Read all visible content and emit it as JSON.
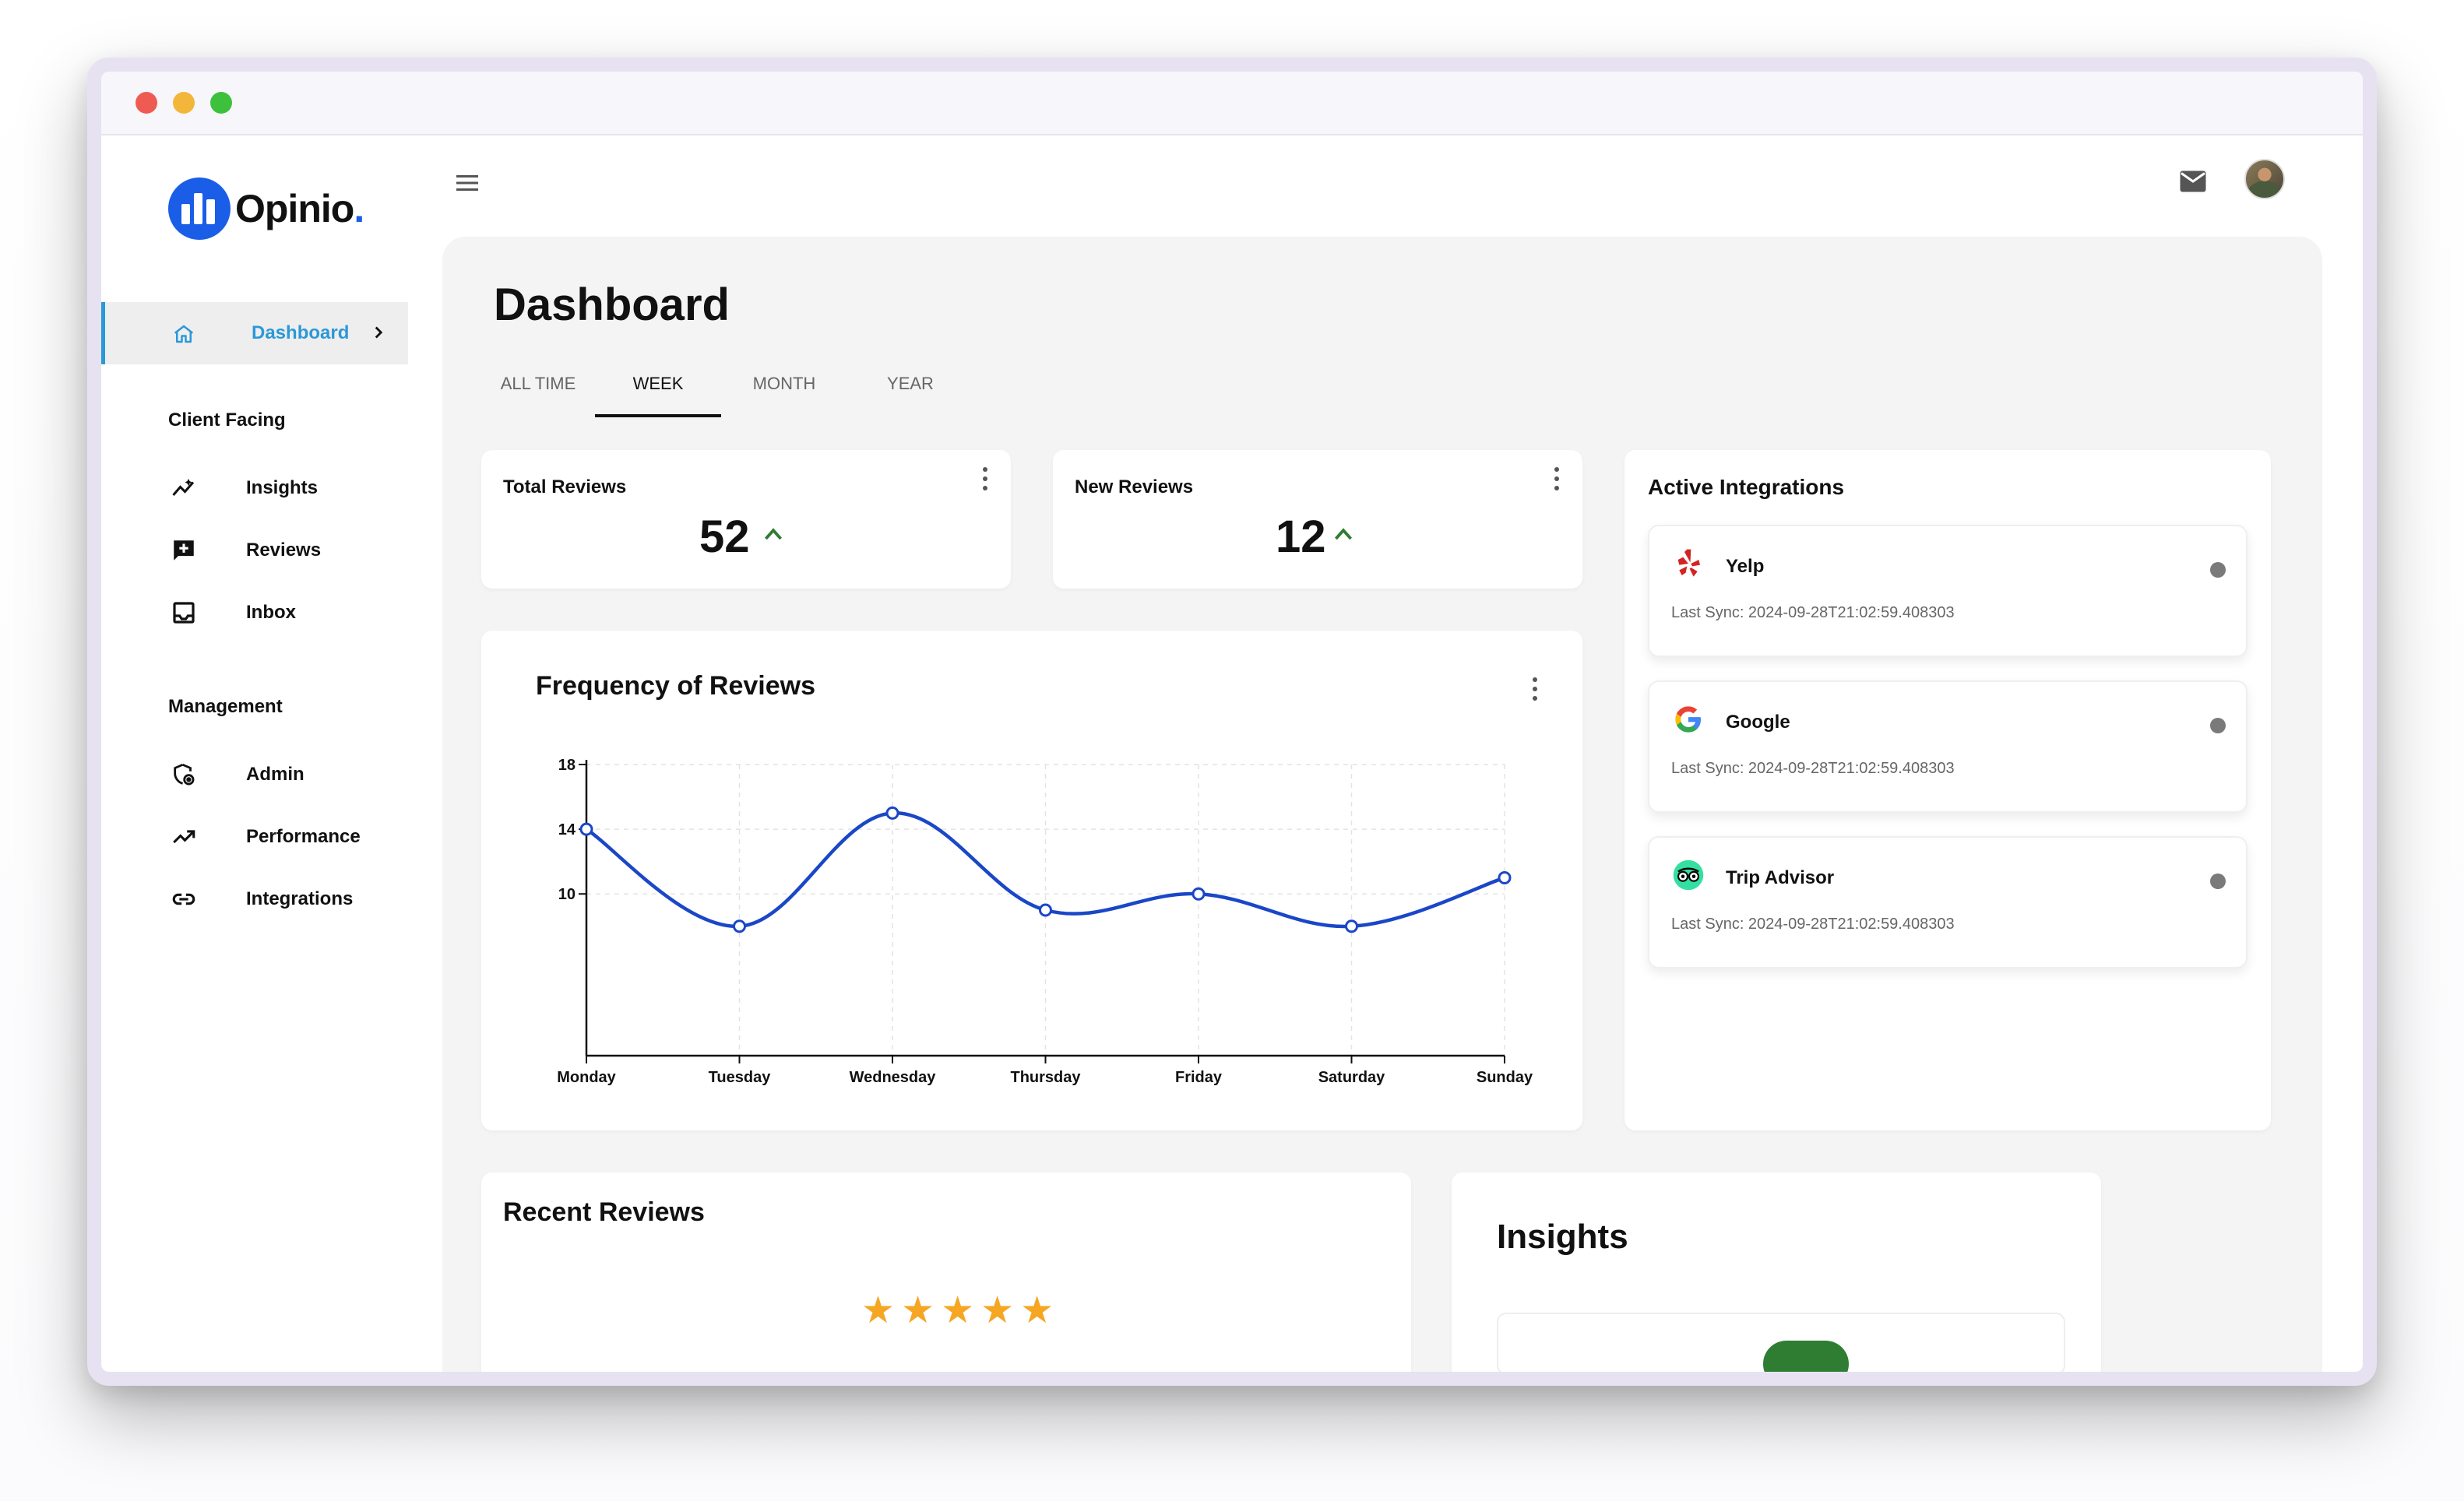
{
  "brand": {
    "name": "Opinio",
    "dot": ".",
    "accent": "#1a5ee8"
  },
  "sidebar": {
    "active": {
      "label": "Dashboard",
      "icon": "home-icon"
    },
    "sections": [
      {
        "title": "Client Facing",
        "items": [
          {
            "label": "Insights",
            "icon": "insights-icon"
          },
          {
            "label": "Reviews",
            "icon": "reviews-icon"
          },
          {
            "label": "Inbox",
            "icon": "inbox-icon"
          }
        ]
      },
      {
        "title": "Management",
        "items": [
          {
            "label": "Admin",
            "icon": "admin-icon"
          },
          {
            "label": "Performance",
            "icon": "trending-up-icon"
          },
          {
            "label": "Integrations",
            "icon": "link-icon"
          }
        ]
      }
    ]
  },
  "page": {
    "title": "Dashboard",
    "tabs": [
      "ALL TIME",
      "WEEK",
      "MONTH",
      "YEAR"
    ],
    "active_tab": "WEEK"
  },
  "stats": {
    "total": {
      "label": "Total Reviews",
      "value": "52"
    },
    "new": {
      "label": "New Reviews",
      "value": "12"
    }
  },
  "frequency": {
    "title": "Frequency of Reviews",
    "chart_data": {
      "type": "line",
      "categories": [
        "Monday",
        "Tuesday",
        "Wednesday",
        "Thursday",
        "Friday",
        "Saturday",
        "Sunday"
      ],
      "values": [
        14,
        8,
        15,
        9,
        10,
        8,
        11
      ],
      "yticks": [
        "18",
        "14",
        "10"
      ],
      "ylim": [
        0,
        18
      ],
      "grid": true,
      "color": "#1a47c7"
    }
  },
  "integrations": {
    "title": "Active Integrations",
    "items": [
      {
        "name": "Yelp",
        "sync": "Last Sync: 2024-09-28T21:02:59.408303",
        "icon": "yelp-icon"
      },
      {
        "name": "Google",
        "sync": "Last Sync: 2024-09-28T21:02:59.408303",
        "icon": "google-icon"
      },
      {
        "name": "Trip Advisor",
        "sync": "Last Sync: 2024-09-28T21:02:59.408303",
        "icon": "tripadvisor-icon"
      }
    ]
  },
  "recent": {
    "title": "Recent Reviews",
    "rating": 5
  },
  "insights": {
    "title": "Insights"
  }
}
